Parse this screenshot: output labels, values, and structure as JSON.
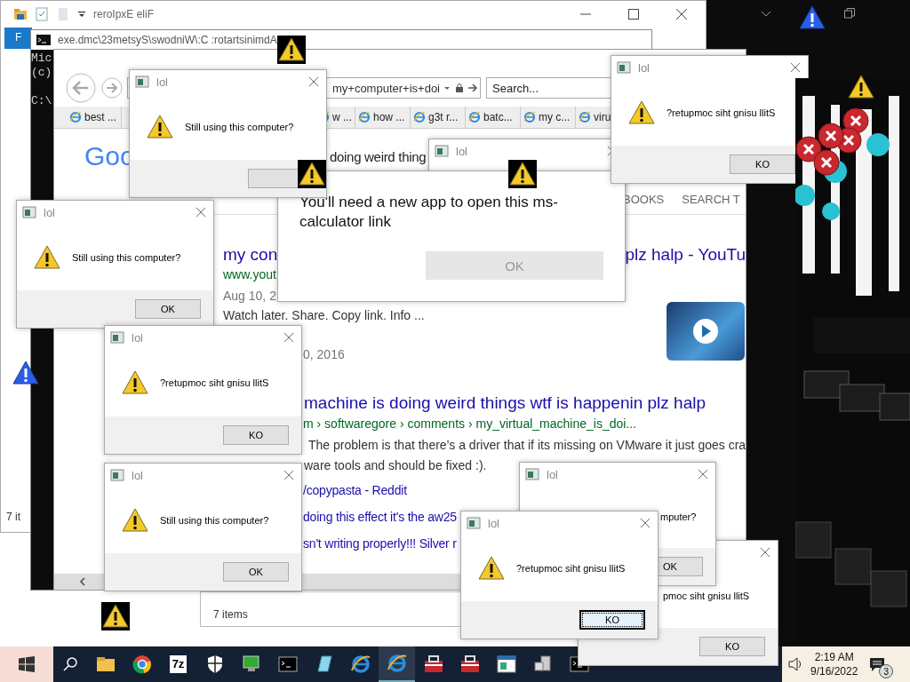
{
  "explorer_windows": [
    {
      "title": "reroIpxE eliF",
      "menu": "F",
      "status": "7 it"
    },
    {
      "status": "7 items"
    }
  ],
  "console_window": {
    "title": "exe.dmc\\23metsyS\\swodniW\\:C :rotartsinimdA",
    "lines": [
      "Mic",
      "(c)",
      "C:\\"
    ]
  },
  "browser_window": {
    "address": "my+computer+is+doi",
    "search": {
      "placeholder": "Search..."
    },
    "tabs": [
      {
        "label": "best ..."
      },
      {
        "label": "w ..."
      },
      {
        "label": "how ..."
      },
      {
        "label": "g3t r..."
      },
      {
        "label": "batc..."
      },
      {
        "label": "my c..."
      },
      {
        "label": "viru"
      }
    ],
    "logo": "Goo",
    "heading_fragment": "doing weird thing",
    "result_tabs": [
      "BOOKS",
      "SEARCH T"
    ],
    "results": [
      {
        "kind": "heading",
        "parts": [
          "my con",
          "plz halp - YouTu"
        ]
      },
      {
        "kind": "url",
        "parts": [
          "www.yout"
        ]
      },
      {
        "kind": "date",
        "parts": [
          "Aug 10, 2"
        ]
      },
      {
        "kind": "text",
        "parts": [
          "Watch later. Share. Copy link. Info ..."
        ]
      },
      {
        "kind": "date",
        "parts": [
          "0, 2016"
        ]
      },
      {
        "kind": "heading",
        "parts": [
          "machine is doing weird things wtf is happenin plz halp"
        ]
      },
      {
        "kind": "url",
        "parts": [
          "m › softwaregore › comments › my_virtual_machine_is_doi..."
        ]
      },
      {
        "kind": "text",
        "parts": [
          "The problem is that there's a driver that if its missing on VMware it just goes cra"
        ]
      },
      {
        "kind": "text",
        "parts": [
          "ware tools and should be fixed :)."
        ]
      },
      {
        "kind": "link",
        "parts": [
          "/copypasta - Reddit"
        ]
      },
      {
        "kind": "link",
        "parts": [
          "doing this effect it's the aw25"
        ]
      },
      {
        "kind": "link",
        "parts": [
          "sn't writing properly!!! Silver r"
        ]
      }
    ]
  },
  "dialogs": [
    {
      "kind": "message_box",
      "title": "lol",
      "icon": true,
      "message": "Still using this computer?",
      "focused": false
    },
    {
      "kind": "message_box",
      "title": "lol"
    },
    {
      "kind": "message_box",
      "title": "lol",
      "icon": true,
      "message": "?retupmoc siht gnisu llitS",
      "button": "KO",
      "focused": false
    },
    {
      "kind": "app_prompt",
      "message": "You'll need a new app to open this ms-calculator link",
      "button": "OK",
      "disabled": true
    },
    {
      "kind": "message_box",
      "title": "lol",
      "icon": true,
      "message": "Still using this computer?",
      "button": "OK",
      "focused": false
    },
    {
      "kind": "message_box",
      "title": "lol",
      "icon": true,
      "message": "?retupmoc siht gnisu llitS",
      "button": "KO",
      "focused": false
    },
    {
      "kind": "message_box",
      "title": "lol",
      "icon": true,
      "message": "Still using this computer?",
      "button": "OK",
      "focused": false
    },
    {
      "kind": "message_box",
      "title": "lol",
      "icon": false,
      "message": "mputer?",
      "button": "OK",
      "focused": false
    },
    {
      "kind": "message_box",
      "title": "lol",
      "icon": true,
      "message": "?retupmoc siht gnisu llitS",
      "button": "KO",
      "focused": true
    },
    {
      "kind": "message_box",
      "icon": false,
      "message": "pmoc siht gnisu llitS",
      "button": "KO",
      "focused": false
    }
  ],
  "alerts": [
    {
      "kind": "warning"
    },
    {
      "kind": "warning"
    },
    {
      "kind": "warning"
    },
    {
      "kind": "warning"
    },
    {
      "kind": "info"
    },
    {
      "kind": "info"
    },
    {
      "kind": "warning"
    }
  ],
  "taskbar": {
    "apps": [
      {
        "kind": "folder",
        "selected": false
      },
      {
        "kind": "browser",
        "selected": false
      },
      {
        "kind": "archive",
        "label": "7z",
        "selected": false
      },
      {
        "kind": "shield",
        "selected": false
      },
      {
        "kind": "monitor",
        "selected": false
      },
      {
        "kind": "console",
        "selected": false
      },
      {
        "kind": "notepad",
        "selected": false
      },
      {
        "kind": "ie",
        "selected": false
      },
      {
        "kind": "ie",
        "selected": true
      },
      {
        "kind": "toolbox",
        "selected": false
      },
      {
        "kind": "toolbox",
        "selected": false
      },
      {
        "kind": "window",
        "selected": false
      },
      {
        "kind": "computer",
        "selected": false
      },
      {
        "kind": "console",
        "selected": false
      }
    ],
    "clock": {
      "time": "2:19 AM",
      "date": "9/16/2022"
    },
    "notifications": {
      "count": "3"
    }
  }
}
